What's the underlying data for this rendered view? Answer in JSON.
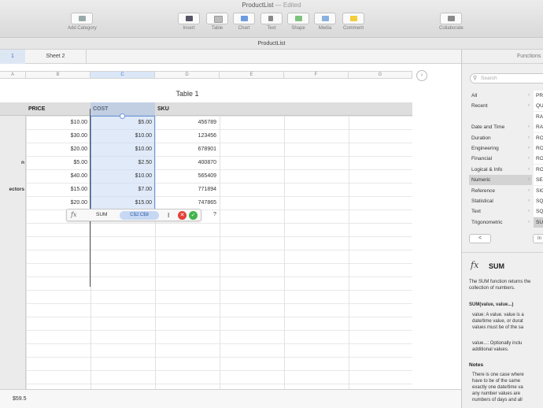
{
  "window": {
    "title": "ProductList",
    "edited": "— Edited"
  },
  "toolbar": {
    "add_category": "Add Category",
    "insert": "Insert",
    "table": "Table",
    "chart": "Chart",
    "text": "Text",
    "shape": "Shape",
    "media": "Media",
    "comment": "Comment",
    "collaborate": "Collaborate"
  },
  "document": {
    "name": "ProductList"
  },
  "sheets": [
    {
      "label": "1"
    },
    {
      "label": "Sheet 2"
    }
  ],
  "columns": [
    "A",
    "B",
    "C",
    "D",
    "E",
    "F",
    "G"
  ],
  "table": {
    "title": "Table 1",
    "headers": {
      "price": "PRICE",
      "cost": "COST",
      "sku": "SKU"
    },
    "rows": [
      {
        "label": "",
        "price": "$10.00",
        "cost": "$5.00",
        "sku": "456789"
      },
      {
        "label": "",
        "price": "$30.00",
        "cost": "$10.00",
        "sku": "123456"
      },
      {
        "label": "",
        "price": "$20.00",
        "cost": "$10.00",
        "sku": "678901"
      },
      {
        "label": "n",
        "price": "$5.00",
        "cost": "$2.50",
        "sku": "400870"
      },
      {
        "label": "",
        "price": "$40.00",
        "cost": "$10.00",
        "sku": "565409"
      },
      {
        "label": "ectors",
        "price": "$15.00",
        "cost": "$7.00",
        "sku": "771894"
      },
      {
        "label": "",
        "price": "$20.00",
        "cost": "$15.00",
        "sku": "747865"
      }
    ]
  },
  "formula": {
    "fx": "fx",
    "function": "SUM",
    "range": "C$2:C$8",
    "cancel": "✕",
    "accept": "✓",
    "question": "?"
  },
  "status": {
    "value": "$59.5"
  },
  "functions_panel": {
    "header": "Functions",
    "search_placeholder": "Search",
    "categories": [
      {
        "name": "All",
        "fn": "PROB"
      },
      {
        "name": "Recent",
        "fn": "QUO"
      },
      {
        "name": "",
        "fn": "RAD"
      },
      {
        "name": "Date and Time",
        "fn": "RAN"
      },
      {
        "name": "Duration",
        "fn": "ROM"
      },
      {
        "name": "Engineering",
        "fn": "ROU"
      },
      {
        "name": "Financial",
        "fn": "ROU"
      },
      {
        "name": "Logical & Info",
        "fn": "ROU"
      },
      {
        "name": "Numeric",
        "fn": "SER"
      },
      {
        "name": "Reference",
        "fn": "SIG"
      },
      {
        "name": "Statistical",
        "fn": "SQR"
      },
      {
        "name": "Text",
        "fn": "SQR"
      },
      {
        "name": "Trigonometric",
        "fn": "SUM"
      }
    ],
    "prev": "<",
    "insert_fn": "In",
    "function_icon": "fx",
    "function_title": "SUM",
    "description": [
      "The SUM function returns the",
      "collection of numbers."
    ],
    "syntax": "SUM(value, value...)",
    "args": [
      [
        "value: A value. value is a",
        "date/time value, or durat",
        "values must be of the sa"
      ],
      [
        "value...: Optionally inclu",
        "additional values."
      ]
    ],
    "notes_header": "Notes",
    "notes": [
      "There is one case where",
      "have to be of the same",
      "exactly one date/time va",
      "any number values are",
      "numbers of days and all"
    ]
  }
}
